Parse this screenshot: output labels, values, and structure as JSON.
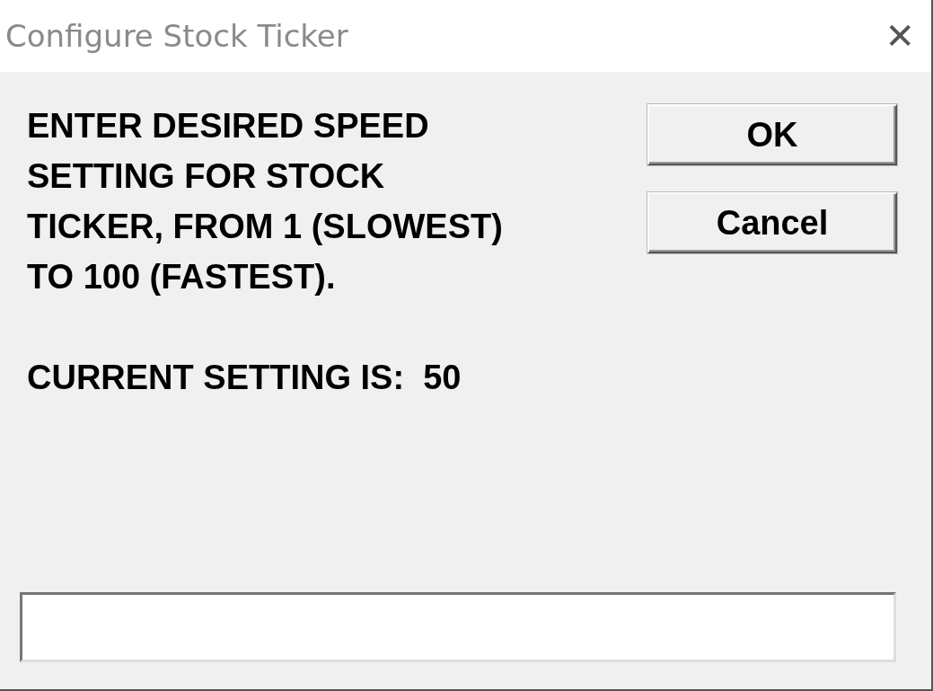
{
  "window": {
    "title": "Configure Stock Ticker",
    "close": "✕"
  },
  "message": "ENTER DESIRED SPEED\nSETTING FOR STOCK\nTICKER, FROM 1 (SLOWEST)\nTO 100 (FASTEST).",
  "current_setting": "CURRENT SETTING IS:  50",
  "buttons": [
    {
      "label": "OK"
    },
    {
      "label": "Cancel"
    }
  ]
}
